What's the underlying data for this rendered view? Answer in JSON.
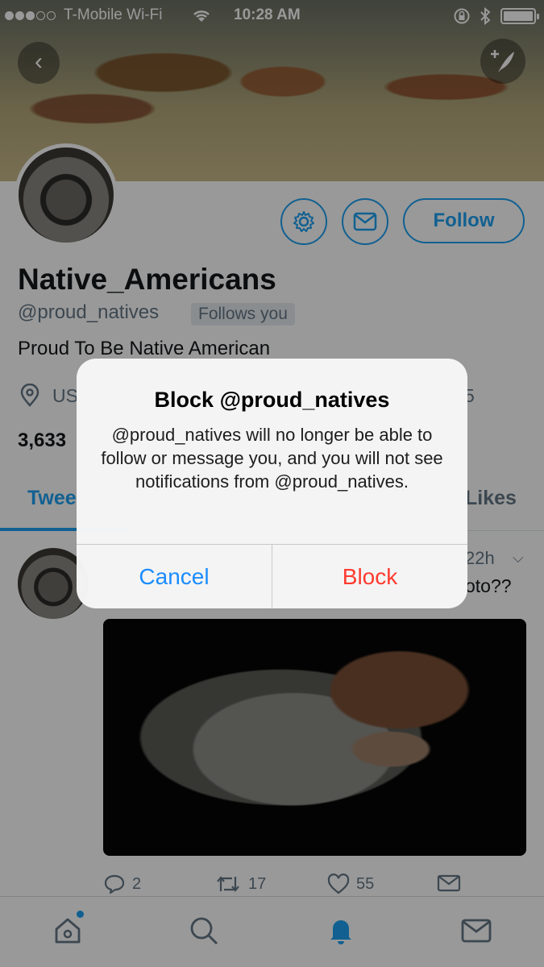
{
  "status_bar": {
    "carrier": "T-Mobile Wi-Fi",
    "time": "10:28 AM",
    "signal_bars_filled": 3,
    "signal_bars_total": 5
  },
  "profile": {
    "display_name": "Native_Americans",
    "handle": "@proud_natives",
    "follows_you": "Follows you",
    "bio": "Proud To Be Native American",
    "location": "US",
    "joined_fragment": "5",
    "stat_count": "3,633",
    "follow_label": "Follow"
  },
  "tabs": {
    "tweets": "Twee",
    "likes": "Likes"
  },
  "tweet": {
    "time": "22h",
    "text_fragment": "oto??",
    "reply_count": "2",
    "retweet_count": "17",
    "like_count": "55"
  },
  "alert": {
    "title": "Block @proud_natives",
    "message": "@proud_natives will no longer be able to follow or message you, and you will not see notifications from @proud_natives.",
    "cancel_label": "Cancel",
    "block_label": "Block"
  },
  "colors": {
    "accent": "#1da1f2",
    "destructive": "#ff3b30",
    "ios_blue": "#1a8cff",
    "secondary_text": "#657786"
  },
  "icons": {
    "back": "chevron-left-icon",
    "compose": "feather-plus-icon",
    "settings": "gear-icon",
    "message": "envelope-icon",
    "location": "location-pin-icon",
    "reply": "reply-icon",
    "retweet": "retweet-icon",
    "like": "heart-icon",
    "dm": "envelope-icon",
    "home": "home-icon",
    "search": "search-icon",
    "notifications": "bell-icon",
    "messages": "envelope-icon"
  }
}
